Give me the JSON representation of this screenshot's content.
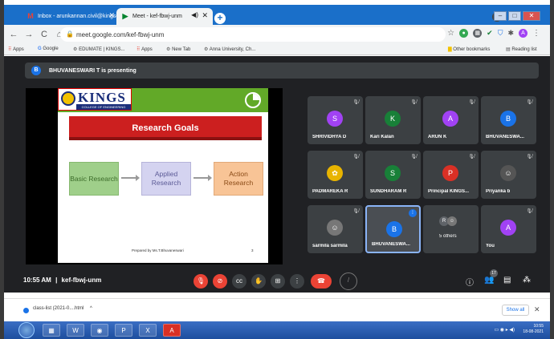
{
  "browser": {
    "tabs": [
      {
        "label": "Inbox - arunkannan.civil@kingsc",
        "icon": "gmail-icon"
      },
      {
        "label": "Meet - kef-fbwj-unm",
        "icon": "meet-icon"
      }
    ],
    "url": "meet.google.com/kef-fbwj-unm",
    "bookmarks": [
      "Apps",
      "Google",
      "EDUMATE | KINGS...",
      "Apps",
      "New Tab",
      "Anna University, Ch..."
    ],
    "bookmarks_right": [
      "Other bookmarks",
      "Reading list"
    ],
    "profile_initial": "A"
  },
  "meet": {
    "presenting_initial": "B",
    "presenting_text": "BHUVANESWARI T is presenting",
    "slide": {
      "logo_text": "KINGS",
      "logo_sub": "COLLEGE OF ENGINEERING",
      "title": "Research Goals",
      "boxes": [
        "Basic Research",
        "Applied Research",
        "Action Research"
      ],
      "footer": "Prepared by Ms.T.Bhuvaneswari",
      "page": "3"
    },
    "participants": [
      {
        "initial": "S",
        "name": "SHRIVIDHYA D",
        "color": "#a142f4"
      },
      {
        "initial": "K",
        "name": "Kari Kalan",
        "color": "#188038"
      },
      {
        "initial": "A",
        "name": "ARUN K",
        "color": "#a142f4"
      },
      {
        "initial": "B",
        "name": "BHUVANESWA...",
        "color": "#1a73e8"
      },
      {
        "initial": "",
        "name": "PADMAREKA R",
        "color": "#e8b400"
      },
      {
        "initial": "S",
        "name": "SUNDHARAM R",
        "color": "#188038"
      },
      {
        "initial": "P",
        "name": "Principal KINGS...",
        "color": "#d93025"
      },
      {
        "initial": "",
        "name": "Priyanka b",
        "color": "#555"
      },
      {
        "initial": "",
        "name": "sarmila sarmila",
        "color": "#777"
      },
      {
        "initial": "B",
        "name": "BHUVANESWA...",
        "color": "#1a73e8"
      },
      {
        "initial": "R",
        "name": "5 others",
        "color": "#5f6368"
      },
      {
        "initial": "A",
        "name": "You",
        "color": "#a142f4"
      }
    ],
    "time": "10:55 AM",
    "separator": "|",
    "meeting_code": "kef-fbwj-unm",
    "people_count": "17"
  },
  "download": {
    "file": "class-list (2021-0....html",
    "show_all": "Show all"
  },
  "taskbar": {
    "time": "10:55",
    "date": "18-08-2021"
  }
}
